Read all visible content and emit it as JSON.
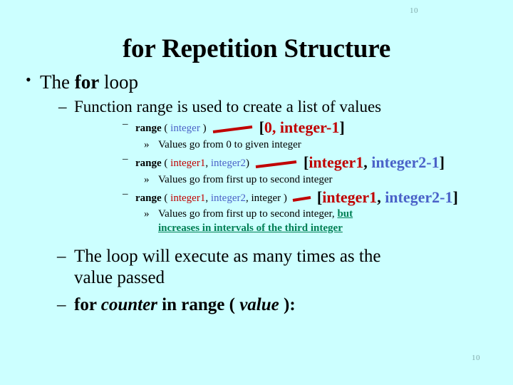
{
  "slide": {
    "background_color": "#ccffff",
    "page_number_top": "10",
    "page_number_bottom": "10",
    "title": {
      "keyword": "for",
      "rest": " Repetition Structure"
    }
  },
  "colors": {
    "blue": "#4a62c8",
    "red": "#c00000",
    "green": "#008055",
    "black": "#000000",
    "page_number": "#7fa8a8"
  },
  "bullets": {
    "level1": {
      "marker": "•",
      "prefix": "The ",
      "keyword": "for",
      "suffix": " loop"
    },
    "level2_intro": {
      "marker": "–",
      "text": "Function range is used to create a list of values"
    }
  },
  "range_forms": [
    {
      "marker": "–",
      "fn": "range",
      "open": " ( ",
      "args": [
        {
          "text": "integer",
          "color": "blue"
        }
      ],
      "separators": [],
      "close": " )",
      "arrow": "red-arrow-icon",
      "arrow_length": 56,
      "result": {
        "open_bracket": "[",
        "parts": [
          {
            "text": "0",
            "color": "red"
          },
          {
            "text": ", ",
            "color": "red"
          },
          {
            "text": "integer-1",
            "color": "red"
          }
        ],
        "close_bracket": "]"
      },
      "note": {
        "marker": "»",
        "text": "Values go from 0 to given integer"
      }
    },
    {
      "marker": "–",
      "fn": "range",
      "open": " ( ",
      "args": [
        {
          "text": "integer1",
          "color": "red"
        },
        {
          "text": "integer2",
          "color": "blue"
        }
      ],
      "separators": [
        ", "
      ],
      "close": ")",
      "arrow": "red-arrow-icon",
      "arrow_length": 58,
      "result": {
        "open_bracket": "[",
        "parts": [
          {
            "text": "integer1",
            "color": "red"
          },
          {
            "text": ", ",
            "color": "black"
          },
          {
            "text": "integer2-1",
            "color": "blue"
          }
        ],
        "close_bracket": "]"
      },
      "note": {
        "marker": "»",
        "text": "Values go from first up to second integer"
      }
    },
    {
      "marker": "–",
      "fn": "range",
      "open": " ( ",
      "args": [
        {
          "text": "integer1",
          "color": "red"
        },
        {
          "text": "integer2",
          "color": "blue"
        },
        {
          "text": "integer",
          "color": "black"
        }
      ],
      "separators": [
        ", ",
        ", "
      ],
      "close": " )",
      "arrow": "red-arrow-icon",
      "arrow_length": 26,
      "result": {
        "open_bracket": "[",
        "parts": [
          {
            "text": "integer1",
            "color": "red"
          },
          {
            "text": ", ",
            "color": "black"
          },
          {
            "text": "integer2-1",
            "color": "blue"
          }
        ],
        "close_bracket": "]"
      },
      "note": {
        "marker": "»",
        "plain": "Values go from first up to second integer, ",
        "highlight_line1": "but",
        "highlight_line2": "increases in intervals of the third integer"
      }
    }
  ],
  "closing": {
    "loop_exec": {
      "marker": "–",
      "line1": "The loop will execute as many times as the",
      "line2": "value passed"
    },
    "syntax": {
      "marker": "–",
      "kw_for": "for ",
      "var_counter": "counter",
      "mid": " in range ( ",
      "var_value": "value",
      "end": " ):"
    }
  }
}
